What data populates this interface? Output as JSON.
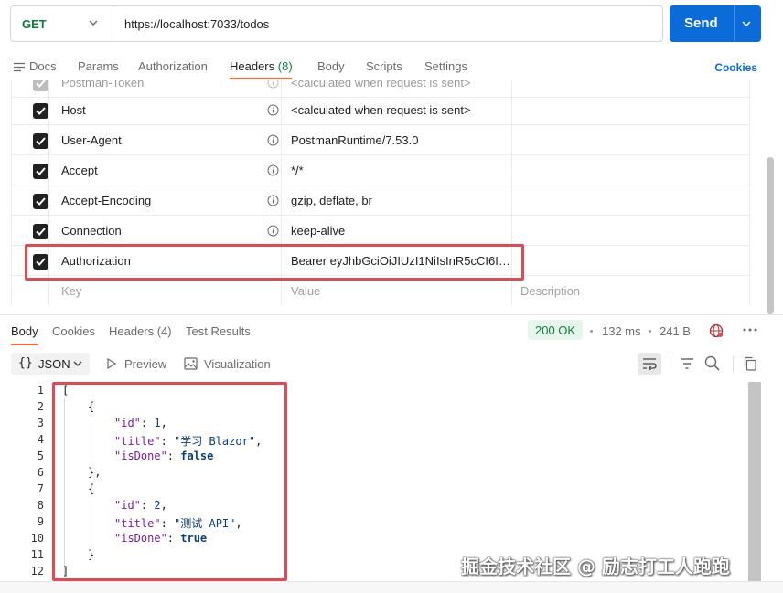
{
  "request": {
    "method": "GET",
    "url": "https://localhost:7033/todos",
    "send_label": "Send"
  },
  "request_tabs": {
    "docs": "Docs",
    "params": "Params",
    "authorization": "Authorization",
    "headers": "Headers",
    "headers_count": "(8)",
    "body": "Body",
    "scripts": "Scripts",
    "settings": "Settings",
    "cookies": "Cookies"
  },
  "headers": {
    "partial_row": {
      "key": "Postman-Token",
      "value": "<calculated when request is sent>"
    },
    "rows": [
      {
        "key": "Host",
        "value": "<calculated when request is sent>"
      },
      {
        "key": "User-Agent",
        "value": "PostmanRuntime/7.53.0"
      },
      {
        "key": "Accept",
        "value": "*/*"
      },
      {
        "key": "Accept-Encoding",
        "value": "gzip, deflate, br"
      },
      {
        "key": "Connection",
        "value": "keep-alive"
      },
      {
        "key": "Authorization",
        "value": "Bearer eyJhbGciOiJIUzI1NiIsInR5cCI6Ikp..."
      }
    ],
    "new_row": {
      "key": "Key",
      "value": "Value",
      "description": "Description"
    }
  },
  "response_tabs": {
    "body": "Body",
    "cookies": "Cookies",
    "headers": "Headers (4)",
    "test_results": "Test Results",
    "status": "200 OK",
    "time": "132 ms",
    "size": "241 B"
  },
  "response_toolbar": {
    "format": "JSON",
    "braces": "{}",
    "preview": "Preview",
    "visualization": "Visualization"
  },
  "code": {
    "line_numbers": [
      "1",
      "2",
      "3",
      "4",
      "5",
      "6",
      "7",
      "8",
      "9",
      "10",
      "11",
      "12"
    ],
    "l1": "[",
    "l2": "{",
    "l3_key": "\"id\"",
    "l3_colon": ": ",
    "l3_val": "1",
    "l3_comma": ",",
    "l4_key": "\"title\"",
    "l4_colon": ": ",
    "l4_val": "\"学习 Blazor\"",
    "l4_comma": ",",
    "l5_key": "\"isDone\"",
    "l5_colon": ": ",
    "l5_val": "false",
    "l6": "},",
    "l7": "{",
    "l8_key": "\"id\"",
    "l8_colon": ": ",
    "l8_val": "2",
    "l8_comma": ",",
    "l9_key": "\"title\"",
    "l9_colon": ": ",
    "l9_val": "\"测试 API\"",
    "l9_comma": ",",
    "l10_key": "\"isDone\"",
    "l10_colon": ": ",
    "l10_val": "true",
    "l11": "}",
    "l12": "]"
  },
  "watermark": "掘金技术社区 @ 励志打工人跑跑",
  "colors": {
    "send_blue": "#0b6cd9",
    "method_green": "#0a7f3f",
    "active_tab": "#ff6c37",
    "annotation_red": "#e04a55"
  },
  "icons": [
    "chevron-down-icon",
    "docs-icon",
    "checkbox-checked-icon",
    "info-icon",
    "globe-icon",
    "more-icon",
    "play-icon",
    "image-icon",
    "wrap-icon",
    "filter-icon",
    "search-icon",
    "copy-icon"
  ]
}
